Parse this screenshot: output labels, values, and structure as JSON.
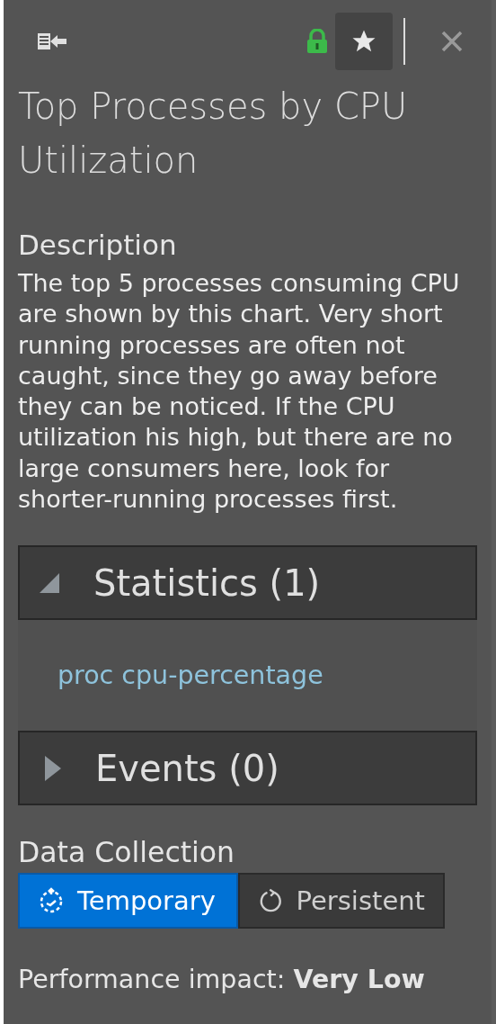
{
  "toolbar": {
    "locked": true,
    "starred": true
  },
  "title": "Top Processes by CPU Utilization",
  "description": {
    "heading": "Description",
    "text": "The top 5 processes consuming CPU are shown by this chart. Very short running processes are often not caught, since they go away before they can be noticed. If the CPU utilization his high, but there are no large consumers here, look for shorter-running processes first."
  },
  "sections": [
    {
      "label": "Statistics (1)",
      "expanded": true,
      "items": [
        "proc cpu-percentage"
      ]
    },
    {
      "label": "Events (0)",
      "expanded": false
    }
  ],
  "data_collection": {
    "heading": "Data Collection",
    "options": [
      {
        "label": "Temporary",
        "kind": "temporary",
        "selected": true
      },
      {
        "label": "Persistent",
        "kind": "persistent",
        "selected": false
      }
    ]
  },
  "performance": {
    "label": "Performance impact:",
    "value": "Very Low"
  }
}
